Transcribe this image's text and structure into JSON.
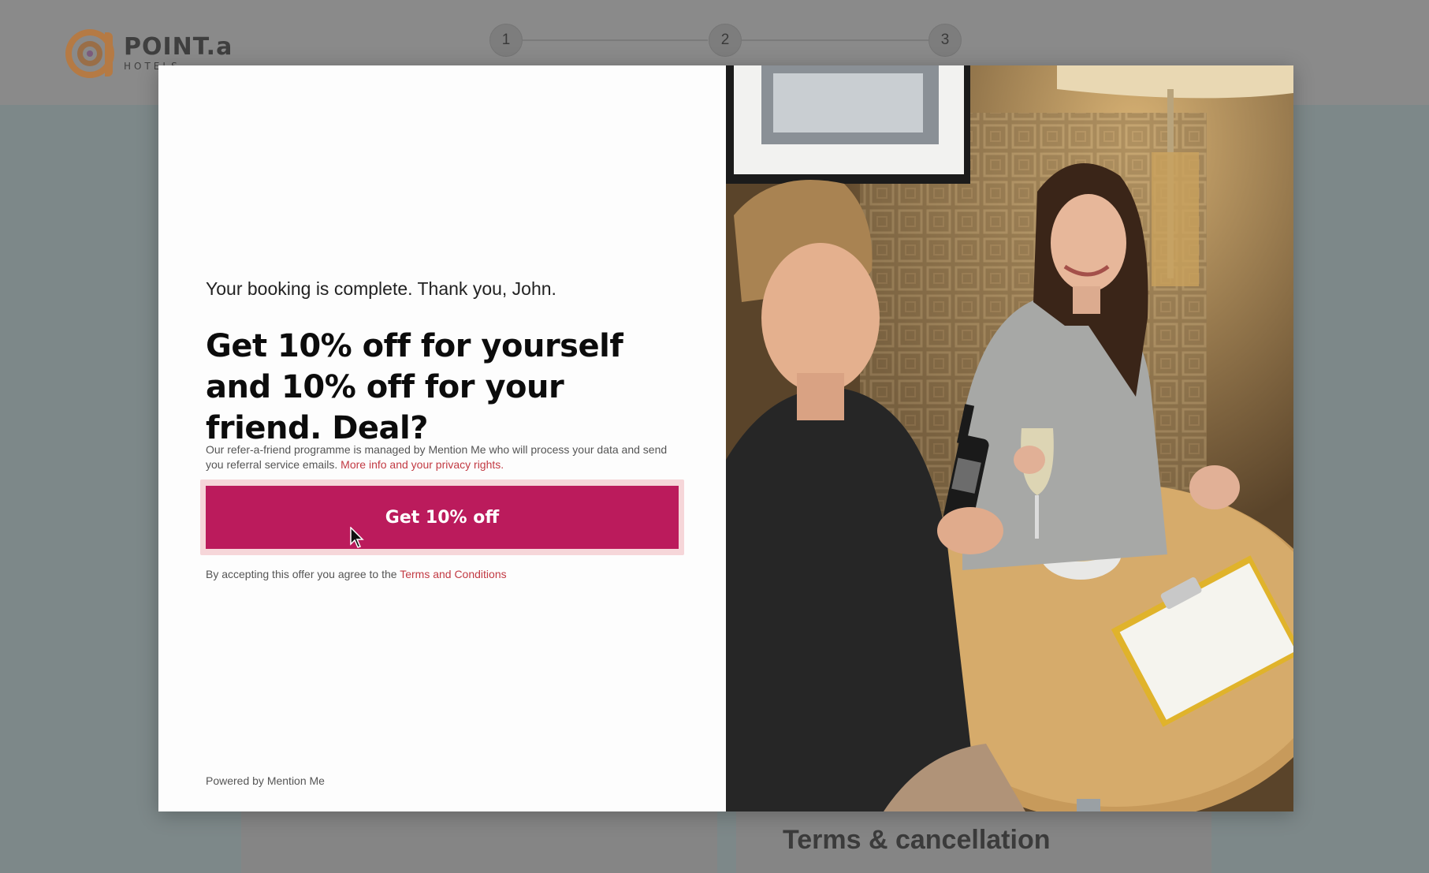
{
  "background": {
    "logo": {
      "name": "POINT.a",
      "sub": "HOTELS"
    },
    "steps": [
      "1",
      "2",
      "3"
    ],
    "section_title": "Terms & cancellation"
  },
  "modal": {
    "subtitle": "Your booking is complete. Thank you, John.",
    "headline": "Get 10% off for yourself and 10% off for your friend. Deal?",
    "disclaimer_text": "Our refer-a-friend programme is managed by Mention Me who will process your data and send you referral service emails.",
    "privacy_link": "More info and your privacy rights.",
    "cta_label": "Get 10% off",
    "terms_prefix": "By accepting this offer you agree to the",
    "terms_link": "Terms and Conditions",
    "powered_by": "Powered by Mention Me"
  },
  "colors": {
    "cta": "#bb1b5c",
    "cta_highlight": "#f6d6d9",
    "link": "#c23a43",
    "logo_orange": "#c98a4b"
  }
}
